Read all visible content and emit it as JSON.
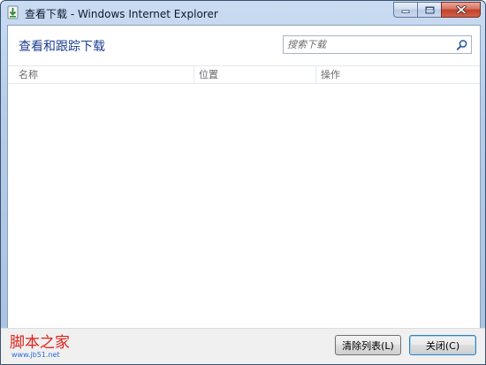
{
  "window": {
    "title": "查看下载 - Windows Internet Explorer"
  },
  "header": {
    "title": "查看和跟踪下载",
    "search_placeholder": "搜索下载"
  },
  "table": {
    "columns": [
      "名称",
      "位置",
      "操作"
    ],
    "rows": []
  },
  "footer": {
    "clear_label": "清除列表(L)",
    "close_label": "关闭(C)",
    "watermark_text": "脚本之家",
    "watermark_url": "www.jb51.net"
  },
  "colors": {
    "title_accent": "#1e3f8f",
    "close_caption": "#c2402a",
    "watermark_red": "#e0211b"
  },
  "icons": {
    "app": "ie-download-icon",
    "search": "search-icon",
    "minimize": "minimize-icon",
    "maximize": "maximize-icon",
    "close": "close-icon"
  }
}
